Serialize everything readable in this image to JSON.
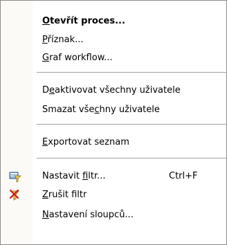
{
  "menu": {
    "items": [
      {
        "pre": "",
        "accel": "O",
        "post": "tevřít proces...",
        "shortcut": "",
        "icon": ""
      },
      {
        "pre": "",
        "accel": "P",
        "post": "říznak...",
        "shortcut": "",
        "icon": ""
      },
      {
        "pre": "",
        "accel": "G",
        "post": "raf workflow...",
        "shortcut": "",
        "icon": ""
      },
      {
        "pre": "D",
        "accel": "e",
        "post": "aktivovat všechny uživatele",
        "shortcut": "",
        "icon": ""
      },
      {
        "pre": "Smazat vše",
        "accel": "c",
        "post": "hny uživatele",
        "shortcut": "",
        "icon": ""
      },
      {
        "pre": "",
        "accel": "E",
        "post": "xportovat seznam",
        "shortcut": "",
        "icon": ""
      },
      {
        "pre": "Nastavit ",
        "accel": "f",
        "post": "iltr...",
        "shortcut": "Ctrl+F",
        "icon": "filter-set-icon"
      },
      {
        "pre": "",
        "accel": "Z",
        "post": "rušit filtr",
        "shortcut": "",
        "icon": "filter-clear-icon"
      },
      {
        "pre": "",
        "accel": "N",
        "post": "astavení sloupců...",
        "shortcut": "",
        "icon": ""
      }
    ]
  }
}
